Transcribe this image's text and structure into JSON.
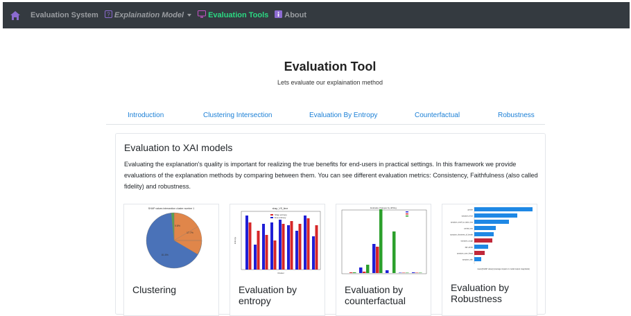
{
  "navbar": {
    "items": [
      {
        "label": "Evaluation System"
      },
      {
        "label": "Explaination Model"
      },
      {
        "label": "Evaluation Tools"
      },
      {
        "label": "About"
      }
    ],
    "active_color": "#2bd982",
    "home_icon": "house-icon",
    "model_icon": "question-square-icon",
    "tools_icon": "monitor-icon",
    "about_icon": "info-square-icon"
  },
  "header": {
    "title": "Evaluation Tool",
    "subtitle": "Lets evaluate our explaination method"
  },
  "tabs": [
    {
      "label": "Introduction"
    },
    {
      "label": "Clustering Intersection"
    },
    {
      "label": "Evaluation By Entropy"
    },
    {
      "label": "Counterfactual"
    },
    {
      "label": "Robustness"
    }
  ],
  "card": {
    "title": "Evaluation to XAI models",
    "text": "Evaluating the explanation's quality is important for realizing the true benefits for end-users in practical settings. In this framework we provide evaluations of the explanation methods by comparing between them. You can see different evaluation metrics: Consistency, Faithfulness (also called fidelity) and robustness."
  },
  "tools": [
    {
      "label": "Clustering",
      "image_title": "SHAP values intersection cluster number 1",
      "slice_labels": [
        "81.5%",
        "17.7%",
        "0.8%"
      ]
    },
    {
      "label": "Evaluation by entropy",
      "image_title": "shap_VS_lime",
      "legend": [
        "Shap entropy",
        "lime entropy"
      ],
      "xlabel": "Cluster",
      "ylabel": "Entropy"
    },
    {
      "label": "Evaluation by counterfactual",
      "image_title": "Evaluate changes by drifting"
    },
    {
      "label": "Evaluation by Robustness",
      "xlabel": "mean(|SHAP value|) (average impact on model output magnitude)",
      "features": [
        "gender",
        "symptom_fever",
        "symptom_smell_or_taste_loss",
        "contact_any",
        "symptom_shortness_of_breath",
        "symptom_cough",
        "age_group",
        "symptom_sore_throat",
        "symptom_skin"
      ]
    }
  ]
}
